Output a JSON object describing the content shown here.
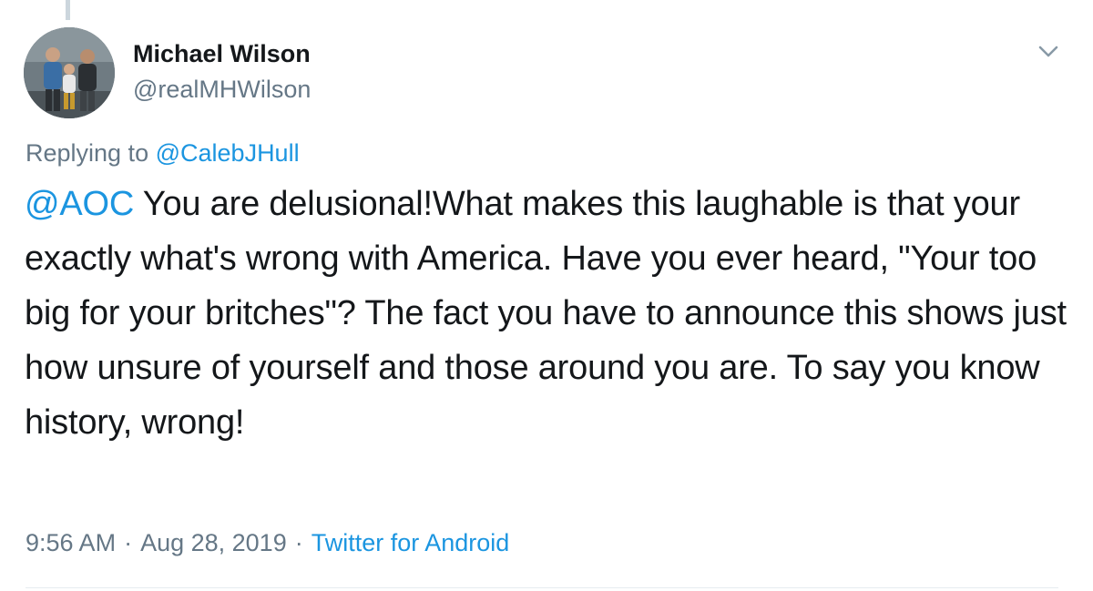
{
  "tweet": {
    "author": {
      "display_name": "Michael Wilson",
      "handle": "@realMHWilson"
    },
    "reply_context": {
      "prefix": "Replying to",
      "mention": "@CalebJHull"
    },
    "body": {
      "mention": "@AOC",
      "text": " You are delusional!What makes this laughable is that your exactly what's wrong with America. Have you ever heard, \"Your too big for your britches\"? The fact you have to announce this shows just how unsure of yourself and those around you are. To say you know history, wrong!"
    },
    "meta": {
      "time": "9:56 AM",
      "separator": "·",
      "date": "Aug 28, 2019",
      "source": "Twitter for Android"
    }
  },
  "icons": {
    "caret": "chevron-down-icon",
    "avatar": "avatar-photo"
  },
  "colors": {
    "link": "#1b95e0",
    "secondary_text": "#657786",
    "primary_text": "#14171a",
    "divider": "#e6ecf0",
    "thread_line": "#ccd6dd"
  }
}
